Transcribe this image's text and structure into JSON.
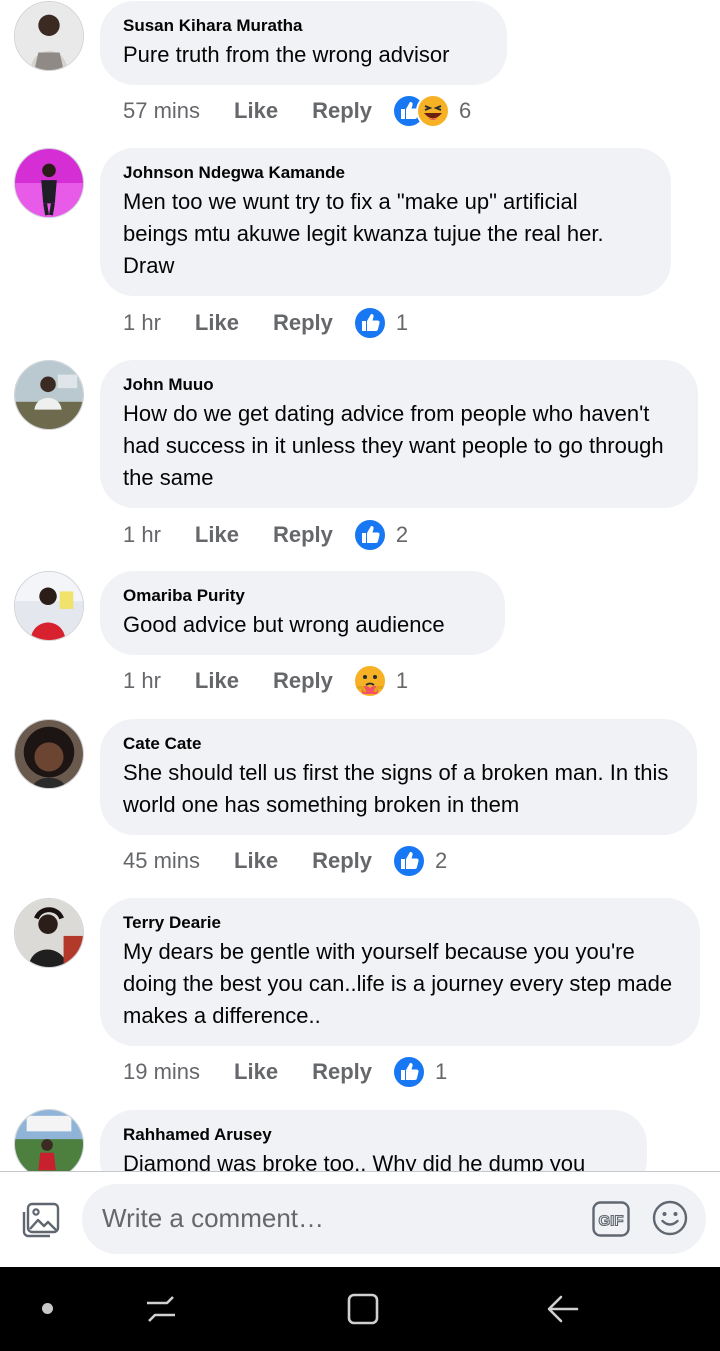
{
  "comments": [
    {
      "author": "Susan Kihara Muratha",
      "text": "Pure truth from the wrong advisor",
      "time": "57 mins",
      "reactions": [
        "like",
        "haha"
      ],
      "count": "6"
    },
    {
      "author": "Johnson Ndegwa Kamande",
      "text": "Men too we wunt try to fix a \"make up\" artificial beings mtu akuwe legit kwanza tujue the real her. Draw",
      "time": "1 hr",
      "reactions": [
        "like"
      ],
      "count": "1"
    },
    {
      "author": "John Muuo",
      "text": "How do we get dating advice from people who haven't had success in it unless they want people to go through the same",
      "time": "1 hr",
      "reactions": [
        "like"
      ],
      "count": "2"
    },
    {
      "author": "Omariba Purity",
      "text": "Good advice but wrong audience",
      "time": "1 hr",
      "reactions": [
        "care"
      ],
      "count": "1"
    },
    {
      "author": "Cate Cate",
      "text": "She should tell us first the signs of a broken man. In this world one has something broken in them",
      "time": "45 mins",
      "reactions": [
        "like"
      ],
      "count": "2"
    },
    {
      "author": "Terry Dearie",
      "text": "My dears be gentle with yourself because you you're doing the best you can..life is a journey every step made makes a difference..",
      "time": "19 mins",
      "reactions": [
        "like"
      ],
      "count": "1"
    },
    {
      "author": "Rahhamed Arusey",
      "text": "Diamond was broke too.. Why did he dump you",
      "time": "",
      "reactions": [],
      "count": ""
    }
  ],
  "actions": {
    "like": "Like",
    "reply": "Reply"
  },
  "composer": {
    "placeholder": "Write a comment…",
    "gif_label": "GIF"
  },
  "colors": {
    "accent": "#1877f2",
    "bubble": "#f0f2f5",
    "meta_text": "#65676b",
    "haha": "#f7b125",
    "navbar": "#000000"
  },
  "icons": {
    "photo": "photo-icon",
    "gif": "gif-icon",
    "emoji": "emoji-icon",
    "like": "like-icon",
    "haha": "haha-icon",
    "care": "care-icon",
    "recent": "recent-apps-icon",
    "home": "home-icon",
    "back": "back-icon"
  }
}
